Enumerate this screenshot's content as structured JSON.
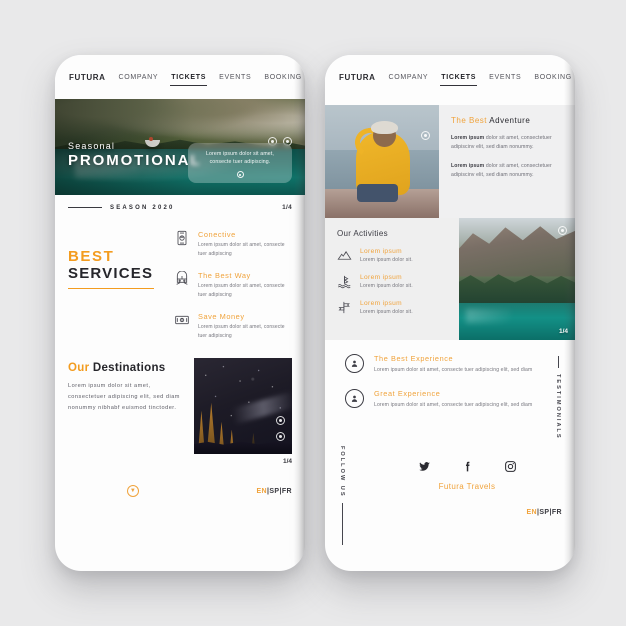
{
  "nav": {
    "brand": "FUTURA",
    "items": [
      {
        "label": "COMPANY",
        "active": false
      },
      {
        "label": "TICKETS",
        "active": true
      },
      {
        "label": "EVENTS",
        "active": false
      },
      {
        "label": "BOOKING",
        "active": false
      }
    ]
  },
  "phone_one": {
    "hero": {
      "kicker": "Seasonal",
      "title": "PROMOTIONAL",
      "card_text": "Lorem ipsum dolor sit amet, consecte tuer adipiscing."
    },
    "season_bar": {
      "label": "SEASON 2020",
      "counter": "1/4"
    },
    "services": {
      "title_line1": "BEST",
      "title_line2": "SERVICES",
      "items": [
        {
          "icon": "smartphone-signal-icon",
          "title": "Conective",
          "desc": "Lorem ipsum dolor sit amet, consecte tuer adipiscing"
        },
        {
          "icon": "train-icon",
          "title": "The Best Way",
          "desc": "Lorem ipsum dolor sit amet, consecte tuer adipiscing"
        },
        {
          "icon": "money-bill-icon",
          "title": "Save Money",
          "desc": "Lorem ipsum dolor sit amet, consecte tuer adipiscing"
        }
      ]
    },
    "destinations": {
      "title_accent": "Our",
      "title_rest": "Destinations",
      "body": "Lorem ipsum dolor sit amet, consectetuer adipiscing elit, sed diam nonummy nibhabf euismod tinctoder.",
      "counter": "1/4"
    },
    "footer": {
      "scroll_icon": "chevron-down-icon",
      "languages": [
        "EN",
        "SP",
        "FR"
      ],
      "lang_separator": "|",
      "active_language": "EN"
    }
  },
  "phone_two": {
    "adventure": {
      "title_accent": "The Best",
      "title_rest": "Adventure",
      "paragraphs": [
        {
          "lead": "Lorem ipsum",
          "rest": " dolor sit amet, consectetuer adipiscinv elit, sed diam nonummy."
        },
        {
          "lead": "Lorem ipsum",
          "rest": " dolor sit amet, consectetuer adipiscinv elit, sed diam nonummy."
        }
      ]
    },
    "activities": {
      "title": "Our Activities",
      "items": [
        {
          "icon": "mountain-icon",
          "title": "Lorem ipsum",
          "desc": "Lorem ipsum dolor sit."
        },
        {
          "icon": "sailboat-water-icon",
          "title": "Lorem ipsum",
          "desc": "Lorem ipsum dolor sit."
        },
        {
          "icon": "signpost-icon",
          "title": "Lorem ipsum",
          "desc": "Lorem ipsum dolor sit."
        }
      ],
      "photo_counter": "1/4"
    },
    "testimonials": {
      "side_label": "TESTIMONIALS",
      "items": [
        {
          "avatar": "user-circle-icon",
          "title": "The Best Experience",
          "desc": "Lorem ipsum dolor sit amet, consecte tuer adipiscing elit, sed diam"
        },
        {
          "avatar": "user-circle-icon",
          "title": "Great Experience",
          "desc": "Lorem ipsum dolor sit amet, consecte tuer adipiscing elit, sed diam"
        }
      ]
    },
    "footer": {
      "follow_label": "FOLLOW US",
      "socials": [
        "twitter-icon",
        "facebook-icon",
        "instagram-icon"
      ],
      "brand_line": "Futura Travels",
      "languages": [
        "EN",
        "SP",
        "FR"
      ],
      "lang_separator": "|",
      "active_language": "EN"
    }
  },
  "colors": {
    "accent": "#f39c1f",
    "accent_soft": "#f0a33c",
    "ink": "#26262b",
    "muted": "#76767e",
    "background": "#e9e9ea",
    "surface": "#fdfdfd"
  }
}
